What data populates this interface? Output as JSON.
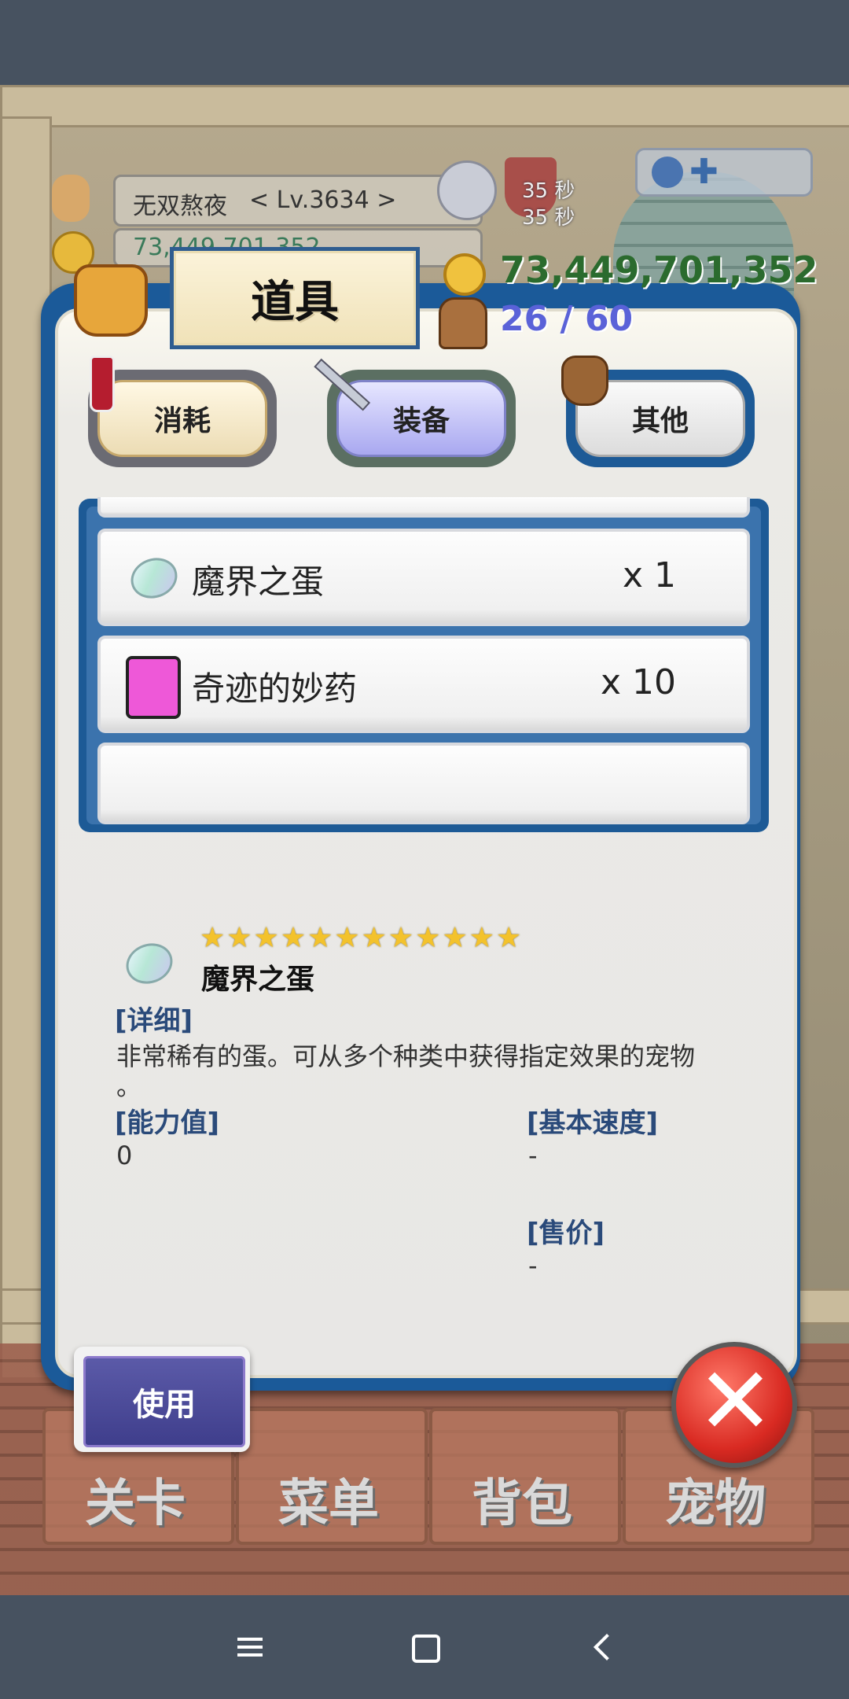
{
  "player": {
    "name": "无双熬夜",
    "level": "< Lv.3634 >",
    "gold_hud_partial": "73,449,701,352"
  },
  "timers": [
    "35 秒",
    "35 秒"
  ],
  "panel": {
    "title": "道具",
    "gold": "73,449,701,352",
    "capacity": "26 / 60"
  },
  "tabs": [
    {
      "label": "消耗",
      "active": false
    },
    {
      "label": "装备",
      "active": true
    },
    {
      "label": "其他",
      "active": false
    }
  ],
  "items": [
    {
      "name": "魔界之蛋",
      "qty": "x 1"
    },
    {
      "name": "奇迹的妙药",
      "qty": "x 10"
    }
  ],
  "detail": {
    "stars": "★★★★★★★★★★★★",
    "name": "魔界之蛋",
    "desc_label": "[详细]",
    "desc_line1": "非常稀有的蛋。可从多个种类中获得指定效果的宠物",
    "desc_line2": "。",
    "ability_label": "[能力值]",
    "ability_value": "0",
    "speed_label": "[基本速度]",
    "speed_value": "-",
    "price_label": "[售价]",
    "price_value": "-"
  },
  "use_button": "使用",
  "bottom_menu": [
    "关卡",
    "菜单",
    "背包",
    "宠物"
  ],
  "colors": {
    "accent_blue": "#1b5a99",
    "gold_text": "#2b6b2e",
    "capacity_text": "#5a62d8",
    "tab_active": "#a9a8f0"
  }
}
